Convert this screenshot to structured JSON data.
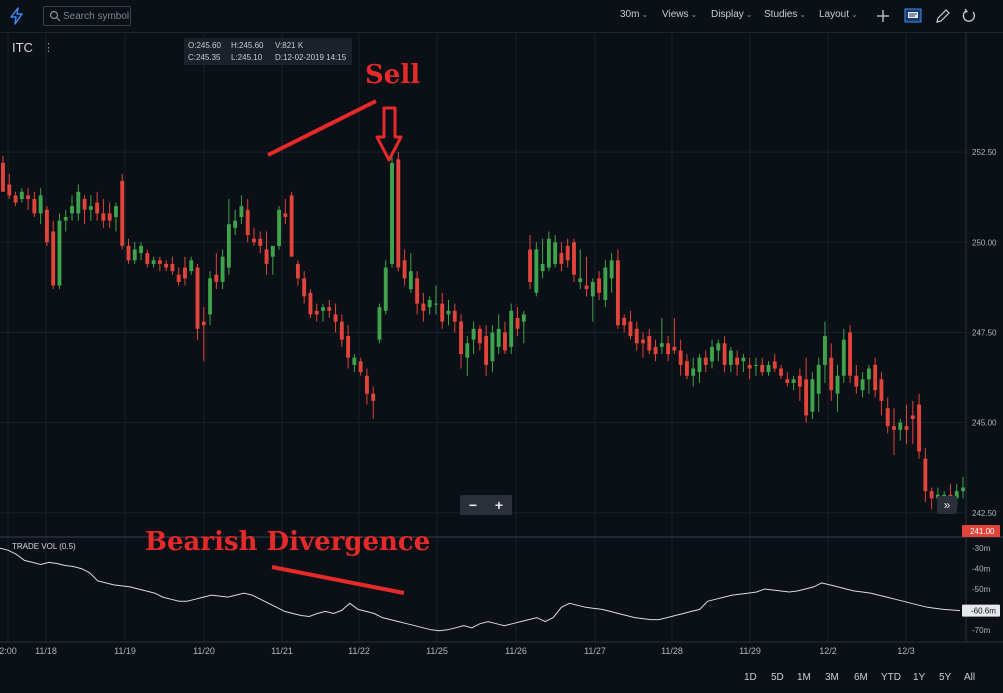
{
  "toolbar": {
    "search_placeholder": "Search symbol",
    "interval": "30m",
    "views": "Views",
    "display": "Display",
    "studies": "Studies",
    "layout": "Layout"
  },
  "symbol": "ITC",
  "ohlc": {
    "open": "O:245.60",
    "high": "H:245.60",
    "volume": "V:821 K",
    "close": "C:245.35",
    "low": "L:245.10",
    "date": "D:12-02-2019 14:15"
  },
  "annotations": {
    "sell": "Sell",
    "divergence": "Bearish Divergence"
  },
  "volume_study_label": "TRADE VOL (0.5)",
  "range_buttons": [
    "1D",
    "5D",
    "1M",
    "3M",
    "6M",
    "YTD",
    "1Y",
    "5Y",
    "All"
  ],
  "colors": {
    "up": "#3fa34d",
    "down": "#e0443a",
    "annotation": "#e52a2a",
    "background": "#0b0f16"
  },
  "chart_data": [
    {
      "type": "candlestick",
      "x_ticks": [
        "2:00",
        "11/18",
        "11/19",
        "11/20",
        "11/21",
        "11/22",
        "11/25",
        "11/26",
        "11/27",
        "11/28",
        "11/29",
        "12/2",
        "12/3"
      ],
      "y_ticks": [
        "252.50",
        "250.00",
        "247.50",
        "245.00",
        "242.50"
      ],
      "ylim": [
        242.3,
        254.0
      ],
      "last_price_label": "241.00",
      "grid": true,
      "candles": [
        [
          252.2,
          252.4,
          251.5,
          251.4
        ],
        [
          251.6,
          251.9,
          251.2,
          251.3
        ],
        [
          251.3,
          251.4,
          251.0,
          251.1
        ],
        [
          251.2,
          251.5,
          251.1,
          251.4
        ],
        [
          251.3,
          251.5,
          250.9,
          251.2
        ],
        [
          251.2,
          251.4,
          250.7,
          250.8
        ],
        [
          250.8,
          251.5,
          250.5,
          251.3
        ],
        [
          250.9,
          251.0,
          249.9,
          250.0
        ],
        [
          250.3,
          250.6,
          248.7,
          248.8
        ],
        [
          248.8,
          250.8,
          248.7,
          250.6
        ],
        [
          250.6,
          250.9,
          250.3,
          250.7
        ],
        [
          250.8,
          251.3,
          250.6,
          251.0
        ],
        [
          250.8,
          251.6,
          250.6,
          251.4
        ],
        [
          251.2,
          251.3,
          250.5,
          250.9
        ],
        [
          250.9,
          251.3,
          250.6,
          251.0
        ],
        [
          251.1,
          251.4,
          250.6,
          250.8
        ],
        [
          250.8,
          251.2,
          250.4,
          250.6
        ],
        [
          250.8,
          251.1,
          250.4,
          250.6
        ],
        [
          250.7,
          251.1,
          250.3,
          251.0
        ],
        [
          251.7,
          251.9,
          249.8,
          249.9
        ],
        [
          249.9,
          250.1,
          249.4,
          249.5
        ],
        [
          249.5,
          250.0,
          249.4,
          249.8
        ],
        [
          249.7,
          250.0,
          249.5,
          249.9
        ],
        [
          249.7,
          249.8,
          249.3,
          249.4
        ],
        [
          249.4,
          249.6,
          249.3,
          249.5
        ],
        [
          249.5,
          249.6,
          249.2,
          249.4
        ],
        [
          249.4,
          249.5,
          249.2,
          249.3
        ],
        [
          249.4,
          249.6,
          249.1,
          249.2
        ],
        [
          249.1,
          249.3,
          248.8,
          248.9
        ],
        [
          249.3,
          249.6,
          248.8,
          249.0
        ],
        [
          249.2,
          249.6,
          249.1,
          249.5
        ],
        [
          249.3,
          249.4,
          247.3,
          247.6
        ],
        [
          247.8,
          248.2,
          246.7,
          247.7
        ],
        [
          248.0,
          249.2,
          247.7,
          249.0
        ],
        [
          249.1,
          249.7,
          248.7,
          248.9
        ],
        [
          248.9,
          249.8,
          248.7,
          249.6
        ],
        [
          249.3,
          251.2,
          249.1,
          250.5
        ],
        [
          250.4,
          250.9,
          250.2,
          250.6
        ],
        [
          250.7,
          251.3,
          250.5,
          251.0
        ],
        [
          250.9,
          251.2,
          250.0,
          250.2
        ],
        [
          250.1,
          250.4,
          249.9,
          250.0
        ],
        [
          250.1,
          250.3,
          249.7,
          249.9
        ],
        [
          249.8,
          250.3,
          249.1,
          249.4
        ],
        [
          249.6,
          249.9,
          249.1,
          249.9
        ],
        [
          249.9,
          251.0,
          249.8,
          250.9
        ],
        [
          250.8,
          251.2,
          250.5,
          250.7
        ],
        [
          251.3,
          251.4,
          249.6,
          249.6
        ],
        [
          249.4,
          249.5,
          248.8,
          249.0
        ],
        [
          249.0,
          249.2,
          248.3,
          248.5
        ],
        [
          248.6,
          248.7,
          247.9,
          248.0
        ],
        [
          248.1,
          248.3,
          247.8,
          248.0
        ],
        [
          248.1,
          248.3,
          247.8,
          248.2
        ],
        [
          248.2,
          248.4,
          247.9,
          248.1
        ],
        [
          248.0,
          248.3,
          247.5,
          247.8
        ],
        [
          247.8,
          248.0,
          247.1,
          247.3
        ],
        [
          247.4,
          247.7,
          246.5,
          246.8
        ],
        [
          246.6,
          246.9,
          246.4,
          246.8
        ],
        [
          246.7,
          246.8,
          246.3,
          246.4
        ],
        [
          246.3,
          246.5,
          245.5,
          245.8
        ],
        [
          245.8,
          246.0,
          245.1,
          245.6
        ],
        [
          247.3,
          248.3,
          247.2,
          248.2
        ],
        [
          248.1,
          249.5,
          248.0,
          249.3
        ],
        [
          249.4,
          252.5,
          249.3,
          252.2
        ],
        [
          252.3,
          252.5,
          249.2,
          249.3
        ],
        [
          249.5,
          249.8,
          248.8,
          249.0
        ],
        [
          248.7,
          249.7,
          248.6,
          249.2
        ],
        [
          249.0,
          249.2,
          248.0,
          248.3
        ],
        [
          248.3,
          248.6,
          247.8,
          248.1
        ],
        [
          248.2,
          248.5,
          248.0,
          248.4
        ],
        [
          248.3,
          248.8,
          248.0,
          248.3
        ],
        [
          248.3,
          248.6,
          247.6,
          247.8
        ],
        [
          248.0,
          248.4,
          247.7,
          248.1
        ],
        [
          248.1,
          248.3,
          247.5,
          247.8
        ],
        [
          247.8,
          248.0,
          246.5,
          246.9
        ],
        [
          246.8,
          247.4,
          246.3,
          247.2
        ],
        [
          247.3,
          247.8,
          246.9,
          247.6
        ],
        [
          247.6,
          247.7,
          247.0,
          247.2
        ],
        [
          247.4,
          247.7,
          246.3,
          246.6
        ],
        [
          246.7,
          247.7,
          246.4,
          247.5
        ],
        [
          247.1,
          248.0,
          246.9,
          247.6
        ],
        [
          247.5,
          247.8,
          246.9,
          247.0
        ],
        [
          247.1,
          248.3,
          246.9,
          248.1
        ],
        [
          247.9,
          248.2,
          247.4,
          247.6
        ],
        [
          247.8,
          248.1,
          247.2,
          248.0
        ],
        [
          249.8,
          250.2,
          248.7,
          248.9
        ],
        [
          248.6,
          250.0,
          248.5,
          249.8
        ],
        [
          249.2,
          250.1,
          249.0,
          249.4
        ],
        [
          249.3,
          250.3,
          249.2,
          250.1
        ],
        [
          249.4,
          250.2,
          249.3,
          250.0
        ],
        [
          249.7,
          250.0,
          249.2,
          249.4
        ],
        [
          249.9,
          250.1,
          249.3,
          249.5
        ],
        [
          250.0,
          250.1,
          248.9,
          249.1
        ],
        [
          248.9,
          249.8,
          248.7,
          249.0
        ],
        [
          248.8,
          249.6,
          248.5,
          248.7
        ],
        [
          248.5,
          249.0,
          247.8,
          248.9
        ],
        [
          249.0,
          249.2,
          248.4,
          248.6
        ],
        [
          248.4,
          249.5,
          248.2,
          249.3
        ],
        [
          249.0,
          249.7,
          248.6,
          249.5
        ],
        [
          249.5,
          249.8,
          247.6,
          247.7
        ],
        [
          247.9,
          248.0,
          247.5,
          247.7
        ],
        [
          247.8,
          248.1,
          247.3,
          247.4
        ],
        [
          247.6,
          247.8,
          247.0,
          247.2
        ],
        [
          247.3,
          247.5,
          246.8,
          247.2
        ],
        [
          247.4,
          247.6,
          246.9,
          247.0
        ],
        [
          247.1,
          247.3,
          246.7,
          246.9
        ],
        [
          247.1,
          247.9,
          246.9,
          247.2
        ],
        [
          247.2,
          247.4,
          246.7,
          246.9
        ],
        [
          247.1,
          247.9,
          246.9,
          247.0
        ],
        [
          247.0,
          247.3,
          246.3,
          246.6
        ],
        [
          246.7,
          246.9,
          246.2,
          246.3
        ],
        [
          246.3,
          246.8,
          246.0,
          246.5
        ],
        [
          246.4,
          246.9,
          246.1,
          246.8
        ],
        [
          246.8,
          247.0,
          246.4,
          246.6
        ],
        [
          246.7,
          247.3,
          246.5,
          247.1
        ],
        [
          247.0,
          247.3,
          246.7,
          247.2
        ],
        [
          247.2,
          247.4,
          246.4,
          246.6
        ],
        [
          246.6,
          247.1,
          246.4,
          247.0
        ],
        [
          246.8,
          247.0,
          246.3,
          246.6
        ],
        [
          246.7,
          246.9,
          246.4,
          246.8
        ],
        [
          246.6,
          246.8,
          246.2,
          246.5
        ],
        [
          246.6,
          246.8,
          246.3,
          246.6
        ],
        [
          246.6,
          246.8,
          246.3,
          246.4
        ],
        [
          246.4,
          246.7,
          246.3,
          246.6
        ],
        [
          246.7,
          246.9,
          246.4,
          246.5
        ],
        [
          246.5,
          246.6,
          246.2,
          246.3
        ],
        [
          246.2,
          246.4,
          246.0,
          246.1
        ],
        [
          246.1,
          246.3,
          245.9,
          246.2
        ],
        [
          246.3,
          246.5,
          245.6,
          246.0
        ],
        [
          246.2,
          246.8,
          245.0,
          245.2
        ],
        [
          245.3,
          246.4,
          245.1,
          246.2
        ],
        [
          245.8,
          246.8,
          245.3,
          246.6
        ],
        [
          246.6,
          247.8,
          246.1,
          247.4
        ],
        [
          246.8,
          247.2,
          245.6,
          245.9
        ],
        [
          245.8,
          246.6,
          245.3,
          246.3
        ],
        [
          246.3,
          247.6,
          246.1,
          247.3
        ],
        [
          247.5,
          247.7,
          246.1,
          246.3
        ],
        [
          246.3,
          246.6,
          245.8,
          246.0
        ],
        [
          245.9,
          246.4,
          245.7,
          246.2
        ],
        [
          246.2,
          246.6,
          245.8,
          246.5
        ],
        [
          246.6,
          246.8,
          245.7,
          245.9
        ],
        [
          246.2,
          246.4,
          245.2,
          245.6
        ],
        [
          245.4,
          245.7,
          244.7,
          244.9
        ],
        [
          244.9,
          245.4,
          244.1,
          244.8
        ],
        [
          244.8,
          245.1,
          244.5,
          245.0
        ],
        [
          244.9,
          245.5,
          244.4,
          244.8
        ],
        [
          245.2,
          245.6,
          244.4,
          245.1
        ],
        [
          245.5,
          245.8,
          244.0,
          244.2
        ],
        [
          244.0,
          244.3,
          242.8,
          243.1
        ],
        [
          243.1,
          243.2,
          242.6,
          242.9
        ],
        [
          242.9,
          243.2,
          242.6,
          243.0
        ],
        [
          242.9,
          243.1,
          242.7,
          243.0
        ],
        [
          243.0,
          243.3,
          242.8,
          242.9
        ],
        [
          242.9,
          243.3,
          242.7,
          243.1
        ],
        [
          243.1,
          243.5,
          242.9,
          243.2
        ]
      ]
    },
    {
      "type": "line",
      "name": "TRADE VOL (0.5)",
      "y_ticks": [
        "-30m",
        "-40m",
        "-50m",
        "-60m",
        "-70m"
      ],
      "ylim": [
        -75,
        -26
      ],
      "last_value_label": "-60.6m",
      "values": [
        -30,
        -31,
        -33,
        -36,
        -37,
        -38,
        -37,
        -37.5,
        -38.5,
        -39,
        -40,
        -42,
        -46,
        -47,
        -48,
        -48.5,
        -49,
        -50,
        -51,
        -52,
        -54,
        -55,
        -56,
        -56,
        -55,
        -54,
        -53,
        -53.5,
        -54,
        -53,
        -52,
        -53,
        -55,
        -57,
        -59,
        -61,
        -62,
        -63,
        -63.5,
        -62,
        -61,
        -62,
        -60.5,
        -57,
        -60,
        -61,
        -62,
        -64,
        -65,
        -66,
        -67,
        -68,
        -69,
        -70,
        -70.5,
        -70,
        -69,
        -68,
        -69,
        -67,
        -66,
        -67,
        -68,
        -67,
        -66,
        -65,
        -64,
        -66,
        -64,
        -59,
        -57,
        -58,
        -59,
        -59.5,
        -60,
        -61,
        -62,
        -63,
        -64,
        -64.5,
        -65,
        -65,
        -64,
        -63,
        -62,
        -61,
        -60,
        -56,
        -55,
        -54,
        -53,
        -52.5,
        -52,
        -51.5,
        -50,
        -50.5,
        -51,
        -51.5,
        -51,
        -50,
        -49,
        -47,
        -48,
        -49,
        -50,
        -51,
        -51.5,
        -52,
        -53,
        -54,
        -55,
        -56,
        -57,
        -58,
        -59,
        -59.5,
        -60,
        -60.3,
        -60.6
      ]
    }
  ]
}
